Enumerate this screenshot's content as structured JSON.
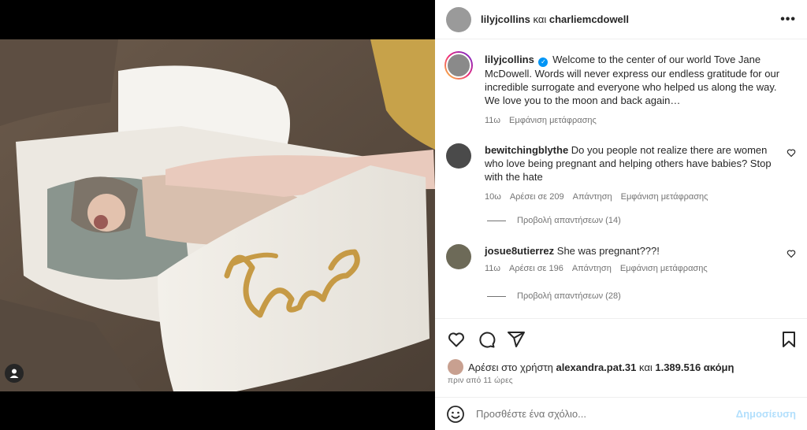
{
  "header": {
    "user1": "lilyjcollins",
    "joiner": "και",
    "user2": "charliemcdowell",
    "more_glyph": "•••"
  },
  "photo": {
    "alt_text": "Tove",
    "icons": {
      "tag": "user-tag-icon"
    }
  },
  "caption": {
    "username": "lilyjcollins",
    "verified_glyph": "✓",
    "text": "Welcome to the center of our world Tove Jane McDowell. Words will never express our endless gratitude for our incredible surrogate and everyone who helped us along the way. We love you to the moon and back again…",
    "age": "11ω",
    "translate": "Εμφάνιση μετάφρασης"
  },
  "comments": [
    {
      "username": "bewitchingblythe",
      "text": "Do you people not realize there are women who love being pregnant and helping others have babies? Stop with the hate",
      "age": "10ω",
      "likes": "Αρέσει σε 209",
      "reply": "Απάντηση",
      "translate": "Εμφάνιση μετάφρασης",
      "view_replies": "Προβολή απαντήσεων (14)"
    },
    {
      "username": "josue8utierrez",
      "text": "She was pregnant???!",
      "age": "11ω",
      "likes": "Αρέσει σε 196",
      "reply": "Απάντηση",
      "translate": "Εμφάνιση μετάφρασης",
      "view_replies": "Προβολή απαντήσεων (28)"
    }
  ],
  "likes_line": {
    "prefix": "Αρέσει στο χρήστη",
    "user": "alexandra.pat.31",
    "conj": "και",
    "count": "1.389.516 ακόμη"
  },
  "timestamp": "πριν από 11 ώρες",
  "add_comment": {
    "placeholder": "Προσθέστε ένα σχόλιο...",
    "post_label": "Δημοσίευση"
  },
  "icons": {
    "like": "heart-icon",
    "comment": "comment-icon",
    "share": "send-icon",
    "save": "bookmark-icon",
    "emoji": "emoji-icon",
    "more": "more-icon"
  },
  "colors": {
    "accent": "#0095f6",
    "post_disabled": "#b2dffc",
    "muted": "#737373"
  }
}
